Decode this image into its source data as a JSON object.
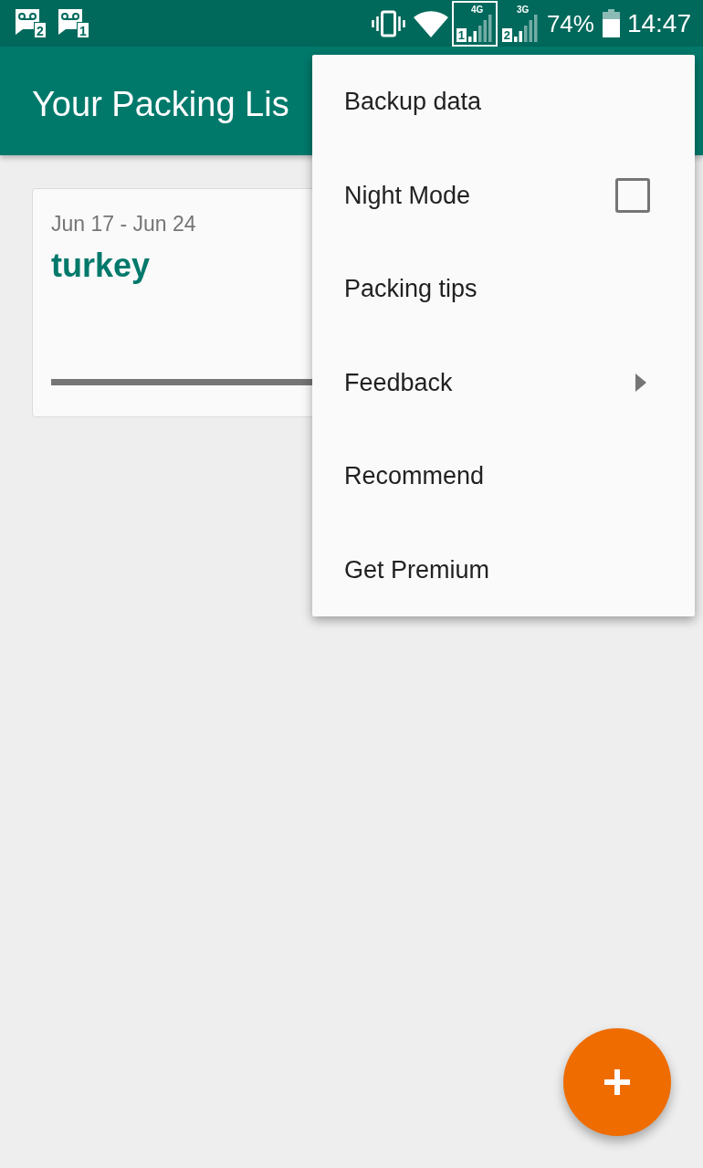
{
  "status_bar": {
    "notifications": [
      {
        "sim": "2"
      },
      {
        "sim": "1"
      }
    ],
    "signals": [
      {
        "network": "4G",
        "sim": "1",
        "active": true
      },
      {
        "network": "3G",
        "sim": "2",
        "active": false
      }
    ],
    "battery": "74%",
    "time": "14:47"
  },
  "app_bar": {
    "title": "Your Packing Lis"
  },
  "trips": [
    {
      "dates": "Jun 17 - Jun 24",
      "name": "turkey",
      "level": 0
    }
  ],
  "menu": {
    "items": [
      {
        "kind": "plain",
        "label": "Backup data"
      },
      {
        "kind": "checkbox",
        "label": "Night Mode",
        "checked": false
      },
      {
        "kind": "plain",
        "label": "Packing tips"
      },
      {
        "kind": "submenu",
        "label": "Feedback"
      },
      {
        "kind": "plain",
        "label": "Recommend"
      },
      {
        "kind": "plain",
        "label": "Get Premium"
      }
    ]
  }
}
